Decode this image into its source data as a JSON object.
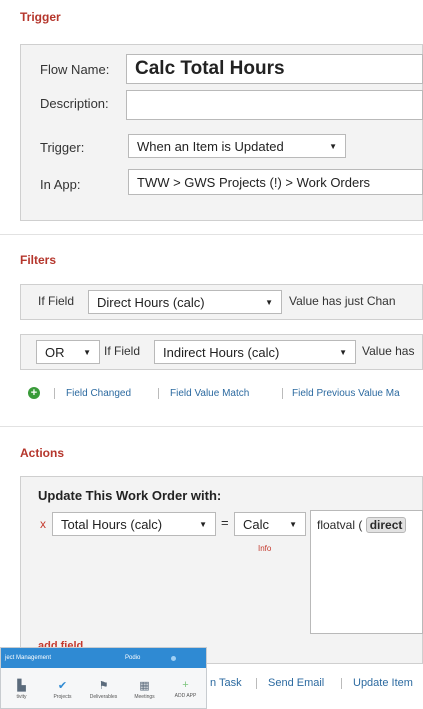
{
  "trigger": {
    "title": "Trigger",
    "flow_name_label": "Flow Name:",
    "flow_name_value": "Calc Total Hours",
    "description_label": "Description:",
    "description_value": "",
    "trigger_label": "Trigger:",
    "trigger_value": "When an Item is Updated",
    "in_app_label": "In App:",
    "in_app_value": "TWW > GWS Projects (!) > Work Orders"
  },
  "filters": {
    "title": "Filters",
    "row1": {
      "if_field_label": "If Field",
      "field_value": "Direct Hours (calc)",
      "condition_text": "Value has just Chan"
    },
    "row2": {
      "operator_value": "OR",
      "if_field_label": "If Field",
      "field_value": "Indirect Hours (calc)",
      "condition_text": "Value has"
    },
    "links": [
      "Field Changed",
      "Field Value Match",
      "Field Previous Value Ma"
    ]
  },
  "actions": {
    "title": "Actions",
    "heading": "Update This Work Order with:",
    "remove_marker": "x",
    "field_value": "Total Hours (calc)",
    "equals": "=",
    "mode_value": "Calc",
    "info_text": "Info",
    "expression_fn": "floatval (",
    "expression_token": "direct",
    "add_field": "add field",
    "bottom_links": [
      "n Task",
      "Send Email",
      "Update Item"
    ]
  },
  "app_overlay": {
    "title": "ject Management",
    "center_label": "Podio",
    "nav": [
      {
        "label": "tivity",
        "icon": "activity-icon"
      },
      {
        "label": "Projects",
        "icon": "projects-icon"
      },
      {
        "label": "Deliverables",
        "icon": "deliverables-icon"
      },
      {
        "label": "Meetings",
        "icon": "meetings-icon"
      },
      {
        "label": "ADD APP",
        "icon": "add-app-icon"
      }
    ]
  },
  "colors": {
    "section_title": "#b5362c",
    "link": "#2c6aa0",
    "panel_bg": "#f3f3f3",
    "add_green": "#3a9b3a",
    "app_bar": "#2f8ad3"
  }
}
